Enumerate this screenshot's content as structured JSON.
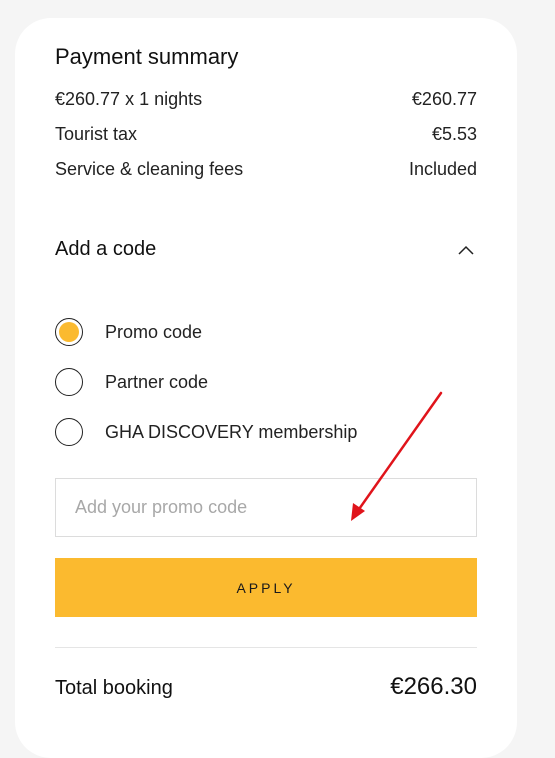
{
  "summary": {
    "title": "Payment summary",
    "rows": [
      {
        "label": "€260.77 x 1 nights",
        "value": "€260.77"
      },
      {
        "label": "Tourist tax",
        "value": "€5.53"
      },
      {
        "label": "Service & cleaning fees",
        "value": "Included"
      }
    ]
  },
  "code_section": {
    "title": "Add a code",
    "expanded": true,
    "toggle_icon": "chevron-up-icon",
    "options": [
      {
        "label": "Promo code",
        "selected": true
      },
      {
        "label": "Partner code",
        "selected": false
      },
      {
        "label": "GHA DISCOVERY membership",
        "selected": false
      }
    ],
    "input": {
      "value": "",
      "placeholder": "Add your promo code"
    },
    "apply_label": "APPLY"
  },
  "total": {
    "label": "Total booking",
    "value": "€266.30"
  },
  "colors": {
    "accent": "#fbba2f",
    "annotation_arrow": "#e0141b"
  }
}
